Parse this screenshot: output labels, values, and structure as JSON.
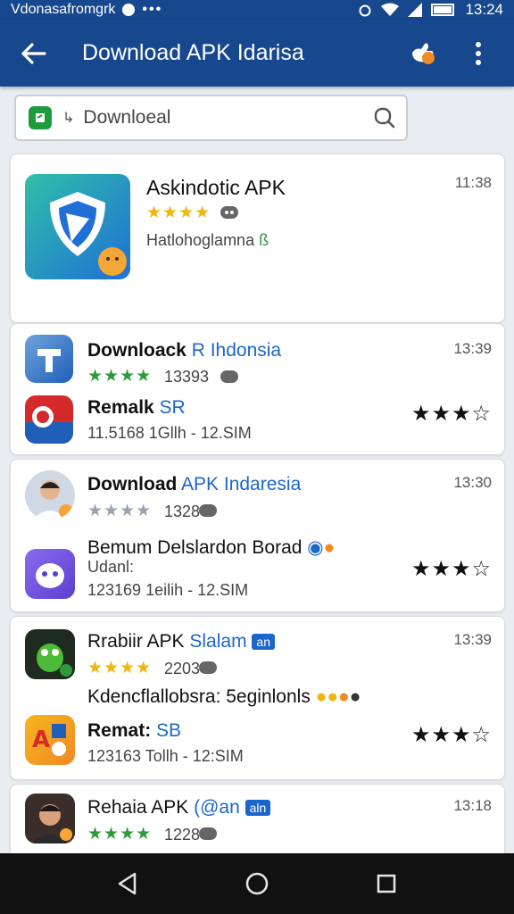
{
  "status_bar": {
    "left_text": "Vdonasafromgrk",
    "time": "13:24",
    "icons": [
      "notification-dot-icon",
      "more-dots-icon",
      "alarm-icon",
      "wifi-icon",
      "signal-icon",
      "battery-icon"
    ]
  },
  "app_bar": {
    "title": "Download APK Idarisa",
    "icons": [
      "back-arrow-icon",
      "share-hand-icon",
      "overflow-menu-icon"
    ]
  },
  "search": {
    "value": "Downloeal",
    "icons": [
      "app-logo-icon",
      "cursor-icon",
      "search-icon"
    ]
  },
  "cards": [
    {
      "items": [
        {
          "name": "Askindotic APK",
          "time": "11:38",
          "subtitle": "Hatlohoglamna",
          "stars": 4
        }
      ]
    },
    {
      "items": [
        {
          "name": "Downloack",
          "name_blue": " R Ihdonsia",
          "time": "13:39",
          "stars": 4,
          "count": "13393"
        },
        {
          "name": "Remalk",
          "name_blue": " SR",
          "meta": "11.5168  1Gllh - 12.SIM",
          "right_stars": 4
        }
      ]
    },
    {
      "items": [
        {
          "name": "Download",
          "name_blue": " APK Indaresia",
          "time": "13:30",
          "stars": 4,
          "count": "1328"
        },
        {
          "name": "Bemum Delslardon Borad",
          "line2": "Udanl:",
          "meta": "123169  1eilih - 12.SIM",
          "right_stars": 4
        }
      ]
    },
    {
      "items": [
        {
          "name": "Rrabiir APK",
          "name_blue": " Slalam",
          "tag": "an",
          "time": "13:39",
          "stars": 4,
          "count": "2203"
        },
        {
          "name": "Kdencflallobsra: 5eginlonls",
          "subtitle_only": true
        },
        {
          "name": "Remat:",
          "name_blue": " SB",
          "meta": "123163  Tollh - 12:SIM",
          "right_stars": 4
        }
      ]
    },
    {
      "items": [
        {
          "name": "Rehaia APK",
          "name_blue": " (@an",
          "tag": "aln",
          "time": "13:18",
          "stars": 4,
          "count": "1228"
        }
      ]
    }
  ],
  "nav_bar": {
    "icons": [
      "back-triangle-icon",
      "home-circle-icon",
      "recents-square-icon"
    ]
  },
  "colors": {
    "primary": "#17478c",
    "star": "#f2b413",
    "green_star": "#2f9a3b",
    "link": "#1b66c9"
  }
}
